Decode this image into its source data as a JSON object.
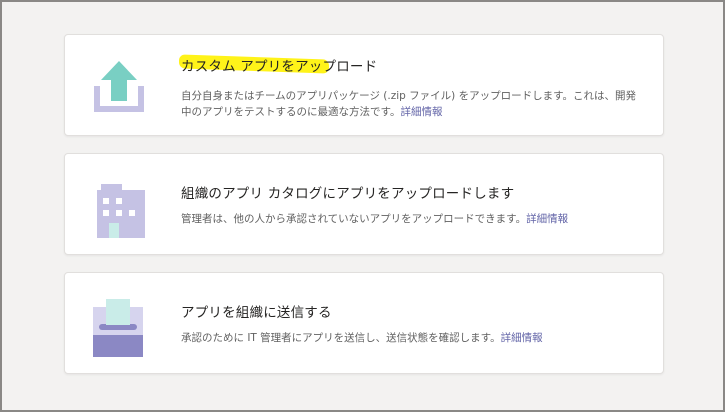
{
  "cards": [
    {
      "title": "カスタム アプリをアップロード",
      "description": "自分自身またはチームのアプリパッケージ (.zip ファイル) をアップロードします。これは、開発中のアプリをテストするのに最適な方法です。",
      "link": "詳細情報"
    },
    {
      "title": "組織のアプリ カタログにアプリをアップロードします",
      "description": "管理者は、他の人から承認されていないアプリをアップロードできます。",
      "link": "詳細情報"
    },
    {
      "title": "アプリを組織に送信する",
      "description": "承認のために IT 管理者にアプリを送信し、送信状態を確認します。",
      "link": "詳細情報"
    }
  ],
  "colors": {
    "upload_arrow": "#79cfc3",
    "tray": "#c5c2e4",
    "building": "#c5c2e4",
    "door": "#c9ece8",
    "submit_box": "#8b88c4",
    "highlight": "#fff200",
    "link": "#6264a7"
  }
}
